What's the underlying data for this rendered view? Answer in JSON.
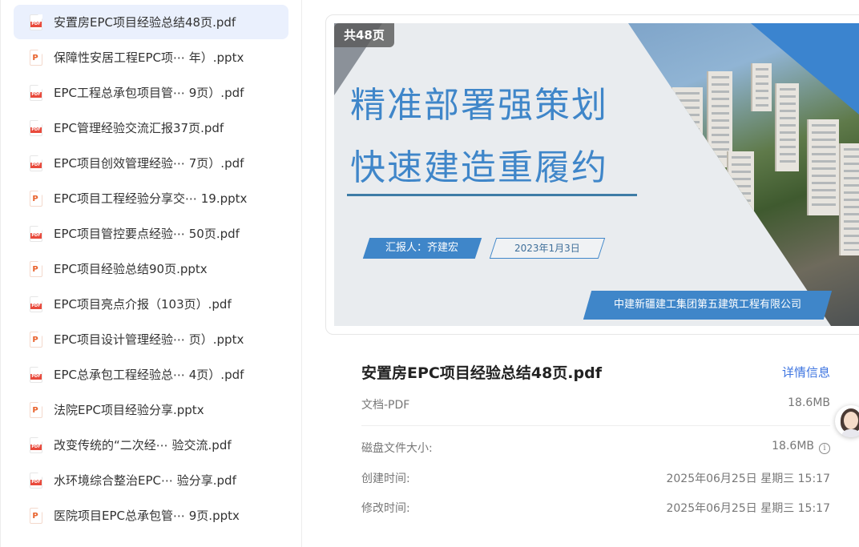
{
  "sidebar": {
    "files": [
      {
        "name": "安置房EPC项目经验总结48页.pdf",
        "type": "pdf",
        "selected": true
      },
      {
        "name": "保障性安居工程EPC项⋯ 年）.pptx",
        "type": "pptx"
      },
      {
        "name": "EPC工程总承包项目管⋯ 9页）.pdf",
        "type": "pdf"
      },
      {
        "name": "EPC管理经验交流汇报37页.pdf",
        "type": "pdf"
      },
      {
        "name": "EPC项目创效管理经验⋯ 7页）.pdf",
        "type": "pdf"
      },
      {
        "name": "EPC项目工程经验分享交⋯ 19.pptx",
        "type": "pptx"
      },
      {
        "name": "EPC项目管控要点经验⋯  50页.pdf",
        "type": "pdf"
      },
      {
        "name": "EPC项目经验总结90页.pptx",
        "type": "pptx"
      },
      {
        "name": "EPC项目亮点介报（103页）.pdf",
        "type": "pdf"
      },
      {
        "name": "EPC项目设计管理经验⋯ 页）.pptx",
        "type": "pptx"
      },
      {
        "name": "EPC总承包工程经验总⋯ 4页）.pdf",
        "type": "pdf"
      },
      {
        "name": "法院EPC项目经验分享.pptx",
        "type": "pptx"
      },
      {
        "name": "改变传统的“二次经⋯  验交流.pdf",
        "type": "pdf"
      },
      {
        "name": "水环境综合整治EPC⋯  验分享.pdf",
        "type": "pdf"
      },
      {
        "name": "医院项目EPC总承包管⋯  9页.pptx",
        "type": "pptx"
      }
    ],
    "icon_labels": {
      "pdf": "PDF",
      "pptx": "P"
    }
  },
  "preview": {
    "page_badge": "共48页",
    "slide": {
      "title_line1": "精准部署强策划",
      "title_line2": "快速建造重履约",
      "reporter": "汇报人：齐建宏",
      "date": "2023年1月3日",
      "company": "中建新疆建工集团第五建筑工程有限公司"
    }
  },
  "details": {
    "title": "安置房EPC项目经验总结48页.pdf",
    "detail_link": "详情信息",
    "doc_type": "文档-PDF",
    "doc_size": "18.6MB",
    "rows": [
      {
        "label": "磁盘文件大小:",
        "value": "18.6MB"
      },
      {
        "label": "创建时间:",
        "value": "2025年06月25日 星期三 15:17"
      },
      {
        "label": "修改时间:",
        "value": "2025年06月25日 星期三 15:17"
      }
    ]
  },
  "colors": {
    "accent": "#3d74e0",
    "selected_bg": "#eaf0fd",
    "slide_blue": "#3f86c9",
    "pdf_red": "#e94a3c",
    "pptx_orange": "#e8622c"
  },
  "icons": {
    "pdf": "pdf-file-icon",
    "pptx": "pptx-file-icon",
    "info": "info-icon",
    "assistant": "assistant-avatar-icon"
  }
}
